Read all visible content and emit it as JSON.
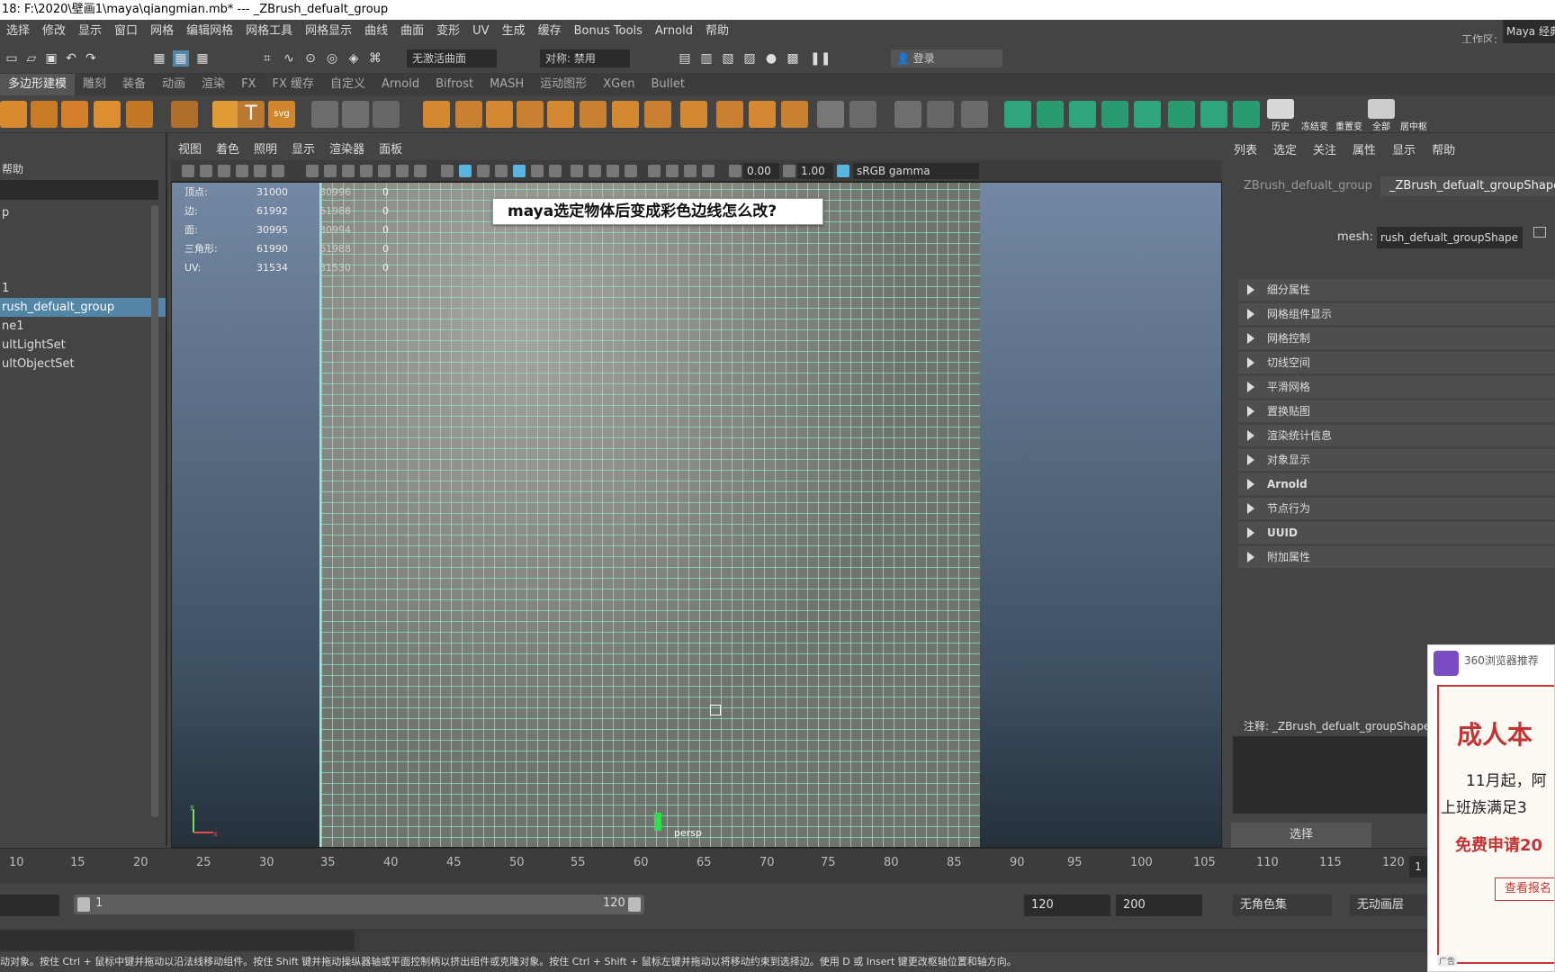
{
  "window": {
    "title": "18: F:\\2020\\壁画1\\maya\\qiangmian.mb*   ---   _ZBrush_defualt_group"
  },
  "menu": [
    "选择",
    "修改",
    "显示",
    "窗口",
    "网格",
    "编辑网格",
    "网格工具",
    "网格显示",
    "曲线",
    "曲面",
    "变形",
    "UV",
    "生成",
    "缓存",
    "Bonus Tools",
    "Arnold",
    "帮助"
  ],
  "workspace": {
    "label": "工作区:",
    "value": "Maya 经典"
  },
  "statusline": {
    "live_surface": "无激活曲面",
    "symmetry": "对称: 禁用",
    "login": "登录"
  },
  "shelf_tabs": [
    "多边形建模",
    "雕刻",
    "装备",
    "动画",
    "渲染",
    "FX",
    "FX 缓存",
    "自定义",
    "Arnold",
    "Bifrost",
    "MASH",
    "运动图形",
    "XGen",
    "Bullet"
  ],
  "shelf_labels": {
    "history": "历史",
    "freeze": "冻结变",
    "reset": "重置变",
    "all": "全部",
    "center": "居中枢"
  },
  "outliner": {
    "menu": "帮助",
    "items": [
      "p",
      "1",
      "rush_defualt_group",
      "ne1",
      "ultLightSet",
      "ultObjectSet"
    ],
    "selected_index": 2
  },
  "viewport": {
    "menu": [
      "视图",
      "着色",
      "照明",
      "显示",
      "渲染器",
      "面板"
    ],
    "exposure": "0.00",
    "gamma": "1.00",
    "colorspace": "sRGB gamma",
    "hud": [
      {
        "label": "顶点:",
        "v1": "31000",
        "v2": "30996",
        "v3": "0"
      },
      {
        "label": "边:",
        "v1": "61992",
        "v2": "61988",
        "v3": "0"
      },
      {
        "label": "面:",
        "v1": "30995",
        "v2": "30994",
        "v3": "0"
      },
      {
        "label": "三角形:",
        "v1": "61990",
        "v2": "61988",
        "v3": "0"
      },
      {
        "label": "UV:",
        "v1": "31534",
        "v2": "31530",
        "v3": "0"
      }
    ],
    "camera": "persp",
    "overlay_text": "maya选定物体后变成彩色边线怎么改?"
  },
  "attribute_editor": {
    "menu": [
      "列表",
      "选定",
      "关注",
      "属性",
      "显示",
      "帮助"
    ],
    "tabs": [
      "ZBrush_defualt_group",
      "_ZBrush_defualt_groupShape"
    ],
    "mesh_label": "mesh:",
    "mesh_value": "rush_defualt_groupShape",
    "sections": [
      "细分属性",
      "网格组件显示",
      "网格控制",
      "切线空间",
      "平滑网格",
      "置换贴图",
      "渲染统计信息",
      "对象显示",
      "Arnold",
      "节点行为",
      "UUID",
      "附加属性"
    ],
    "notes_label": "注释: _ZBrush_defualt_groupShape",
    "select_button": "选择"
  },
  "timeline": {
    "ticks": [
      "10",
      "15",
      "20",
      "25",
      "30",
      "35",
      "40",
      "45",
      "50",
      "55",
      "60",
      "65",
      "70",
      "75",
      "80",
      "85",
      "90",
      "95",
      "100",
      "105",
      "110",
      "115",
      "120"
    ],
    "current_frame": "1"
  },
  "range": {
    "start": "1",
    "end": "120",
    "anim_end": "120",
    "max": "200",
    "charset": "无角色集",
    "layer": "无动画层"
  },
  "ad": {
    "title": "360浏览器推荐",
    "headline": "成人本",
    "line1": "11月起，阿",
    "line2": "上班族满足3",
    "line3": "免费申请20",
    "button": "查看报名",
    "tag": "广告"
  },
  "help_line": "动对象。按住 Ctrl + 鼠标中键并拖动以沿法线移动组件。按住 Shift 键并拖动操纵器轴或平面控制柄以挤出组件或克隆对象。按住 Ctrl + Shift + 鼠标左键并拖动以将移动约束到选择边。使用 D 或 Insert 键更改枢轴位置和轴方向。",
  "colors": {
    "selection": "#5285a6",
    "wireframe": "#82e6be",
    "ad_red": "#c33333",
    "ad_purple": "#7a4cc4"
  }
}
